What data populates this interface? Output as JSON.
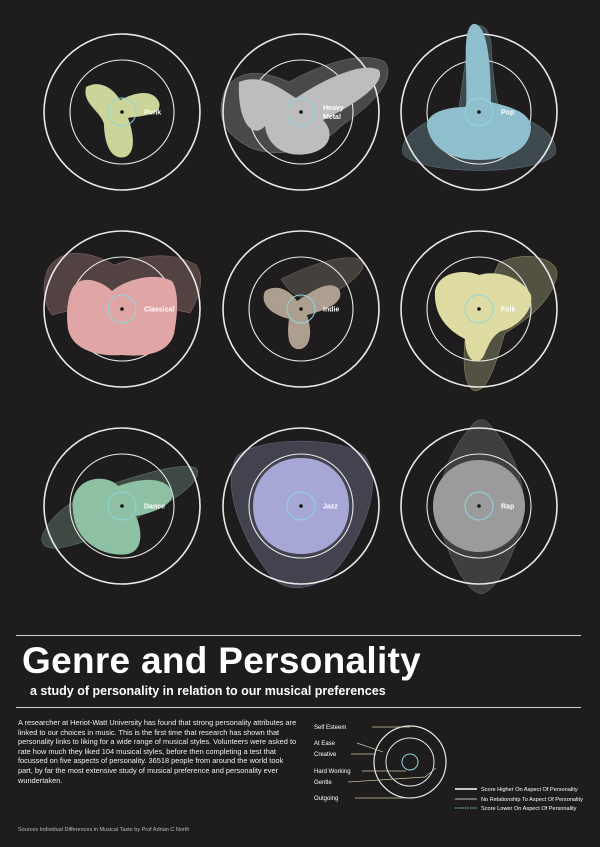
{
  "genres": [
    {
      "name": "Punk",
      "label_lines": [
        "Punk"
      ],
      "color": "#cdd49a"
    },
    {
      "name": "Heavy Metal",
      "label_lines": [
        "Heavy",
        "Metal"
      ],
      "color": "#bdbdbd"
    },
    {
      "name": "Pop",
      "label_lines": [
        "Pop"
      ],
      "color": "#8fbfcc"
    },
    {
      "name": "Classical",
      "label_lines": [
        "Classical"
      ],
      "color": "#e0a6a6"
    },
    {
      "name": "Indie",
      "label_lines": [
        "Indie"
      ],
      "color": "#ad9f8f"
    },
    {
      "name": "Folk",
      "label_lines": [
        "Folk"
      ],
      "color": "#dedca2"
    },
    {
      "name": "Dance",
      "label_lines": [
        "Dance"
      ],
      "color": "#8ec0a4"
    },
    {
      "name": "Jazz",
      "label_lines": [
        "Jazz"
      ],
      "color": "#a7a7d5"
    },
    {
      "name": "Rap",
      "label_lines": [
        "Rap"
      ],
      "color": "#9b9b9b"
    }
  ],
  "header": {
    "title": "Genre and Personality",
    "subtitle": "a study of personality in relation to our musical preferences"
  },
  "description": "A researcher at Heriot-Watt University has found that strong personality attributes are linked to our choices in music. This is the first time that research has shown that personality links to liking for a wide range of musical styles. Volunteers were asked to rate how much they liked 104 musical styles, before then completing a  test that focussed on five aspects of personality. 36518 people from around the world took part, by far the most extensive study of musical preference and personality ever wundertaken.",
  "key": {
    "traits": [
      "Self Esteem",
      "At Ease",
      "Creative",
      "Hard Working",
      "Gentle",
      "Outgoing"
    ]
  },
  "legend": [
    {
      "label": "Score Higher On Aspect Of Personality",
      "color": "#ffffff"
    },
    {
      "label": "No Relationship To Aspect Of Personality",
      "color": "#bbbbbb"
    },
    {
      "label": "Score Lower On Aspect Of Personality",
      "color": "#7fd0dd"
    }
  ],
  "source": "Sources Individual Differences in Musical Taste by Prof Adrian C North",
  "colors": {
    "background": "#1e1c1d",
    "ring": "#e9e9e9",
    "inner_ring": "#8fd6dc",
    "text": "#ffffff"
  }
}
